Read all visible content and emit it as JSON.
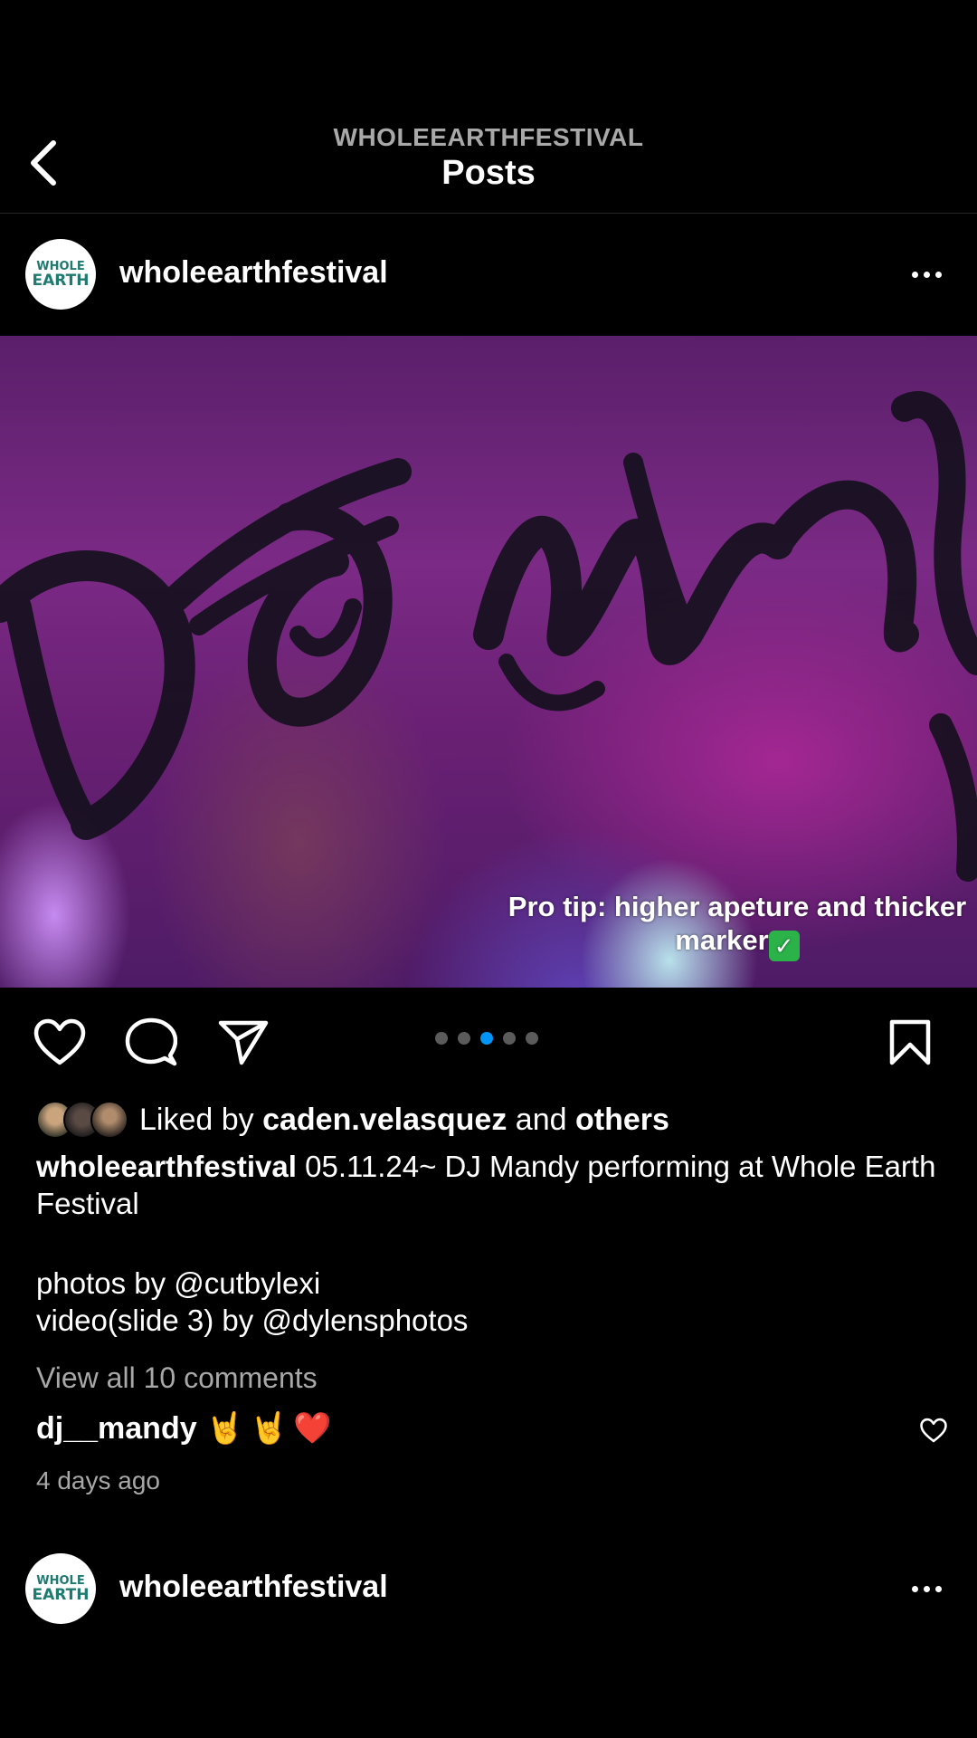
{
  "nav": {
    "account": "WHOLEEARTHFESTIVAL",
    "title": "Posts"
  },
  "post": {
    "username": "wholeearthfestival",
    "avatar_logo": {
      "line1": "WHOLE",
      "line2": "EARTH"
    },
    "media_caption": "Pro tip: higher apeture and thicker marker",
    "media_caption_emoji": "✓",
    "carousel": {
      "total": 5,
      "active_index": 2
    },
    "likes": {
      "prefix": "Liked by",
      "user": "caden.velasquez",
      "conjunction": "and",
      "others": "others"
    },
    "caption": {
      "username": "wholeearthfestival",
      "text": "05.11.24~ DJ Mandy performing at Whole Earth Festival",
      "credit1": "photos by @cutbylexi",
      "credit2": "video(slide 3) by @dylensphotos"
    },
    "view_comments": "View all 10 comments",
    "top_comment": {
      "username": "dj__mandy",
      "text": "🤘🤘❤️"
    },
    "timestamp": "4 days ago"
  },
  "next_post": {
    "username": "wholeearthfestival",
    "avatar_logo": {
      "line1": "WHOLE",
      "line2": "EARTH"
    }
  },
  "colors": {
    "background": "#000000",
    "secondary_text": "#a8a8a8",
    "carousel_active": "#0095f6",
    "carousel_inactive": "#5b5b5b",
    "logo_teal": "#1f7a70",
    "comment_heart": "#e0245e"
  },
  "icons": {
    "back": "chevron-left-icon",
    "more": "more-horizontal-icon",
    "like": "heart-icon",
    "comment": "comment-bubble-icon",
    "share": "paper-plane-icon",
    "save": "bookmark-icon"
  }
}
